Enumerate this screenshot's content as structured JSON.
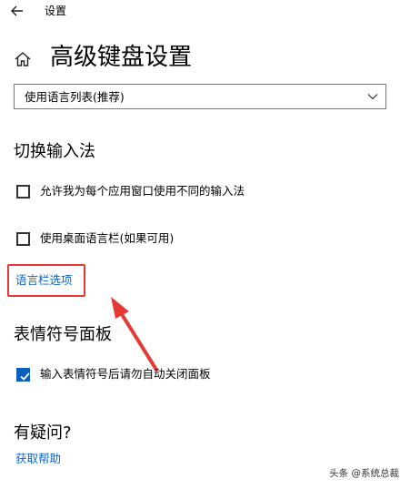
{
  "window": {
    "app_title": "设置"
  },
  "header": {
    "page_title": "高级键盘设置"
  },
  "input_method_select": {
    "selected": "使用语言列表(推荐)"
  },
  "switch_input": {
    "heading": "切换输入法",
    "options": [
      {
        "label": "允许我为每个应用窗口使用不同的输入法",
        "checked": false
      },
      {
        "label": "使用桌面语言栏(如果可用)",
        "checked": false
      }
    ],
    "language_bar_link": "语言栏选项"
  },
  "emoji_panel": {
    "heading": "表情符号面板",
    "option": {
      "label": "输入表情符号后请勿自动关闭面板",
      "checked": true
    }
  },
  "help": {
    "heading": "有疑问?",
    "link": "获取帮助"
  },
  "watermark": {
    "text": "头条 @系统总裁"
  },
  "colors": {
    "accent": "#0a64c8",
    "checkbox_checked": "#0a5fbf",
    "annotation": "#e53935"
  },
  "icons": {
    "back": "arrow-left-icon",
    "home": "home-icon",
    "dropdown": "chevron-down-icon",
    "check": "check-icon"
  }
}
